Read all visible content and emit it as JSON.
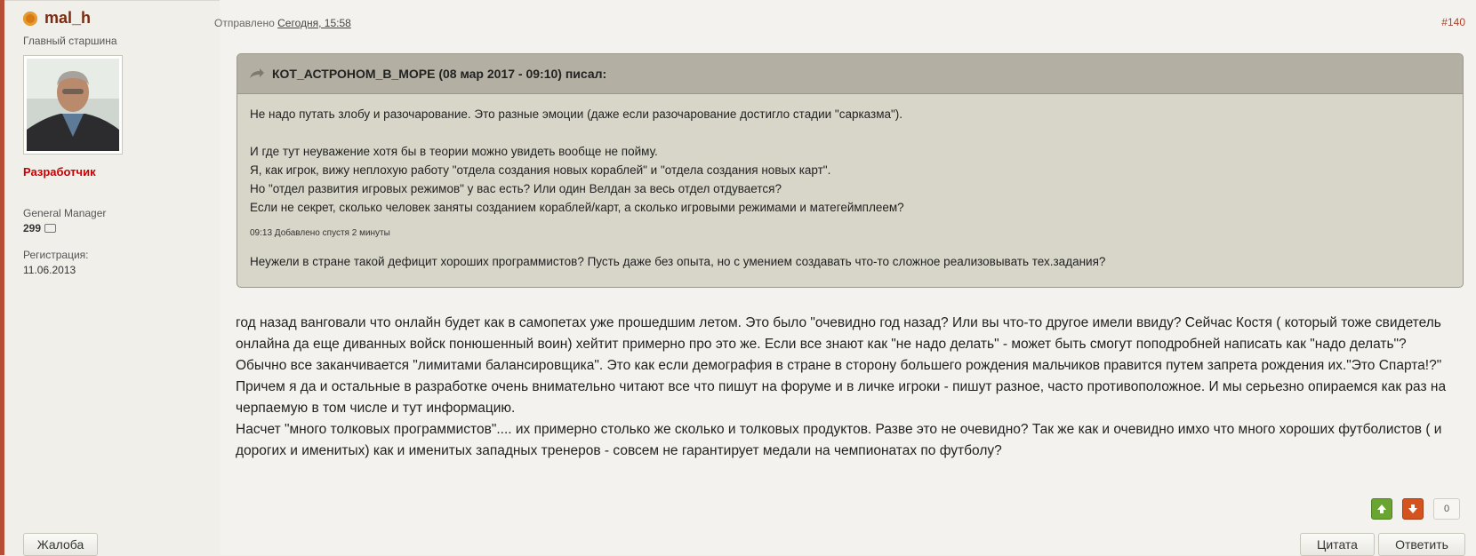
{
  "author": {
    "name": "mal_h",
    "rank": "Главный старшина",
    "role": "Разработчик",
    "position": "General Manager",
    "message_count": "299",
    "registration_label": "Регистрация:",
    "registration_date": "11.06.2013"
  },
  "post": {
    "date_prefix": "Отправлено",
    "date": "Сегодня, 15:58",
    "number": "#140",
    "quote": {
      "header": "КОТ_АСТРОНОМ_В_МОРЕ (08 мар 2017 - 09:10) писал:",
      "lines": [
        "Не надо путать злобу и разочарование. Это разные эмоции (даже если разочарование достигло стадии \"сарказма\").",
        "И где тут неуважение хотя бы в теории можно увидеть вообще не пойму.",
        "Я, как игрок, вижу неплохую работу \"отдела создания новых кораблей\" и \"отдела создания новых карт\".",
        "Но \"отдел развития игровых режимов\" у вас есть? Или один Велдан за весь отдел отдувается?",
        "Если не секрет, сколько человек заняты созданием кораблей/карт, а сколько игровыми режимами и матегеймплеем?"
      ],
      "added_note": "09:13 Добавлено спустя 2 минуты",
      "last_line": "Неужели в стране такой дефицит хороших программистов? Пусть даже без опыта, но с умением создавать что-то сложное  реализовывать тех.задания?"
    },
    "paragraphs": [
      "год назад ванговали что онлайн будет как в самопетах уже прошедшим летом. Это было \"очевидно год назад?  Или вы что-то другое имели ввиду?  Сейчас Костя ( который тоже свидетель онлайна да еще диванных войск понюшенный воин) хейтит примерно про это же.  Если все знают как \"не надо делать\" - может быть смогут поподробней написать как \"надо делать\"?  Обычно все заканчивается \"лимитами балансировщика\".  Это как если демография в стране в сторону большего рождения мальчиков правится путем  запрета рождения их.\"Это Спарта!?\"",
      "Причем я да и остальные в разработке очень внимательно читают все что пишут на форуме и в личке игроки - пишут разное, часто противоположное. И мы серьезно опираемся как раз на черпаемую в том числе и тут информацию.",
      "Насчет  \"много толковых программистов\".... их примерно столько же сколько и толковых продуктов.  Разве это не очевидно? Так же как и очевидно имхо что много хороших футболистов ( и дорогих и именитых) как и именитых западных тренеров - совсем не гарантирует медали на чемпионатах по футболу?"
    ],
    "vote_count": "0"
  },
  "buttons": {
    "report": "Жалоба",
    "quote": "Цитата",
    "reply": "Ответить"
  },
  "colors": {
    "author_name": "#7a2b10",
    "role": "#cc0000",
    "post_number": "#b0412a",
    "vote_up": "#6aa531",
    "vote_down": "#d4531f"
  }
}
